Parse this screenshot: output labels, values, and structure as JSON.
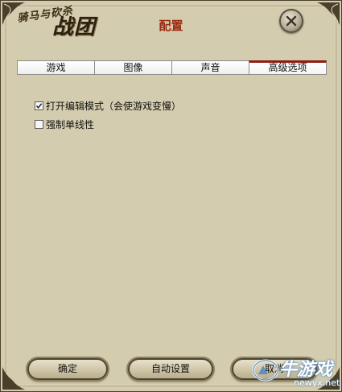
{
  "logo": {
    "small_text": "骑马与砍杀",
    "big_text": "战团"
  },
  "dialog": {
    "title": "配置"
  },
  "tabs": [
    {
      "label": "游戏",
      "active": false
    },
    {
      "label": "图像",
      "active": false
    },
    {
      "label": "声音",
      "active": false
    },
    {
      "label": "高级选项",
      "active": true
    }
  ],
  "options": [
    {
      "label": "打开编辑模式（会使游戏变慢）",
      "checked": true
    },
    {
      "label": "强制单线性",
      "checked": false
    }
  ],
  "buttons": {
    "ok": "确定",
    "auto": "自动设置",
    "cancel": "取消"
  },
  "watermark": {
    "main": "牛游戏",
    "sub": "newyx.net"
  },
  "colors": {
    "panel": "#d4ccae",
    "title": "#9a2a12",
    "active_tab_accent": "#8b1f12"
  },
  "icons": {
    "close": "close-icon",
    "check": "checkmark-icon"
  }
}
